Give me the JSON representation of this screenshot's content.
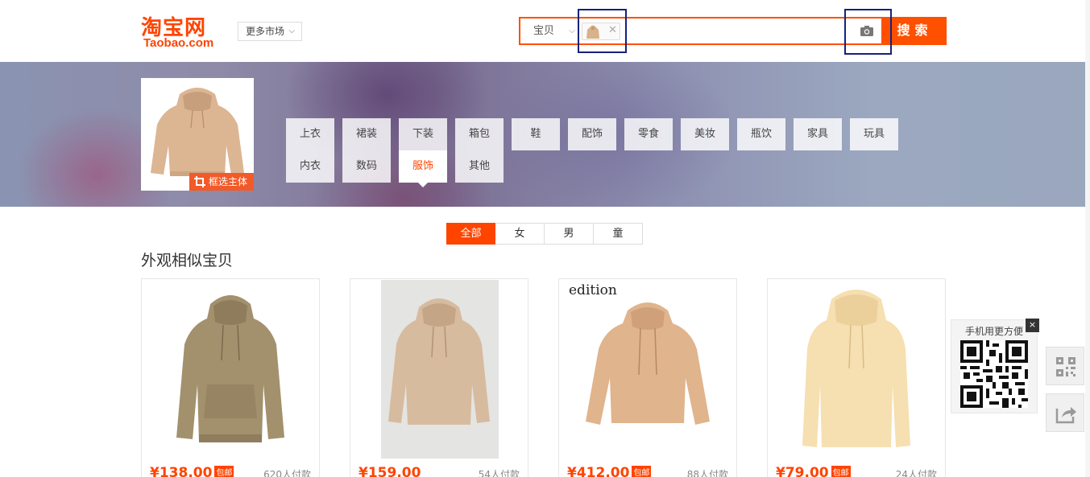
{
  "header": {
    "logo_cn": "淘宝网",
    "logo_en": "Taobao.com",
    "market_label": "更多市场",
    "search": {
      "type_label": "宝贝",
      "placeholder": "",
      "button_label": "搜索"
    }
  },
  "banner": {
    "crop_label": "框选主体",
    "categories_row1": [
      "上衣",
      "裙装",
      "下装",
      "箱包",
      "鞋",
      "配饰",
      "零食",
      "美妆",
      "瓶饮",
      "家具",
      "玩具"
    ],
    "categories_row2": [
      "内衣",
      "数码",
      "服饰",
      "其他"
    ],
    "active_category": "服饰"
  },
  "tabs": [
    "全部",
    "女",
    "男",
    "童"
  ],
  "active_tab": "全部",
  "section_title": "外观相似宝贝",
  "products": [
    {
      "price": "¥138.00",
      "badge": "包邮",
      "sales": "620人付款"
    },
    {
      "price": "¥159.00",
      "badge": "",
      "sales": "54人付款"
    },
    {
      "price": "¥412.00",
      "badge": "包邮",
      "sales": "88人付款",
      "brand": "edition"
    },
    {
      "price": "¥79.00",
      "badge": "包邮",
      "sales": "24人付款"
    }
  ],
  "side": {
    "qr_label": "手机用更方便",
    "close_label": "×"
  },
  "colors": {
    "accent": "#ff5000",
    "price": "#ff4400",
    "highlight_box": "#17217a"
  },
  "icons": [
    "camera-icon",
    "crop-icon",
    "qr-code-icon",
    "share-icon",
    "close-icon"
  ]
}
